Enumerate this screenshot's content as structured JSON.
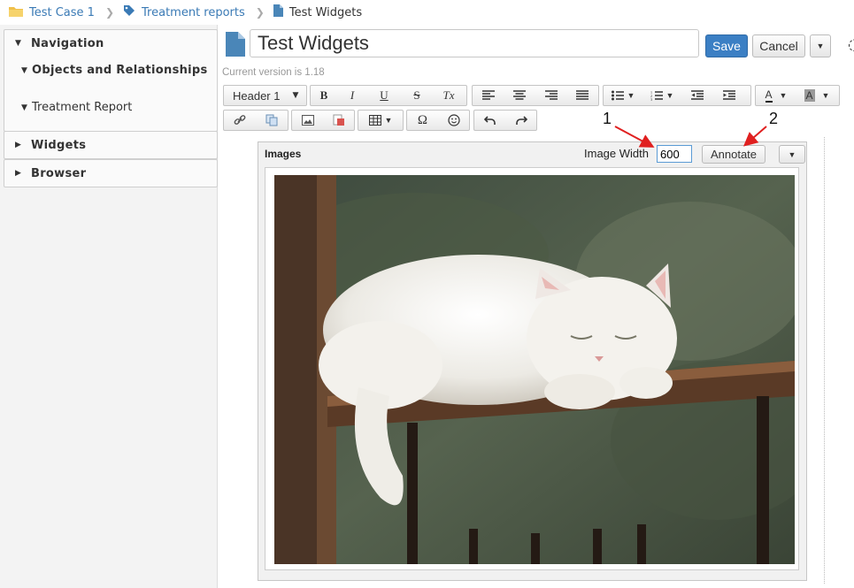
{
  "breadcrumb": {
    "items": [
      {
        "label": "Test Case 1",
        "icon": "folder-icon"
      },
      {
        "label": "Treatment reports",
        "icon": "tag-icon"
      },
      {
        "label": "Test Widgets",
        "icon": "document-icon"
      }
    ]
  },
  "sidebar": {
    "navigation": "Navigation",
    "objects": "Objects and Relationships",
    "treatment": "Treatment Report",
    "widgets": "Widgets",
    "browser": "Browser"
  },
  "editor": {
    "title": "Test Widgets",
    "save": "Save",
    "cancel": "Cancel",
    "version": "Current version is 1.18"
  },
  "toolbar": {
    "format": "Header 1",
    "bold": "B",
    "italic": "I",
    "underline": "U",
    "strike": "S",
    "clear": "Tx",
    "omega": "Ω",
    "text_color": "A",
    "bg_color": "A"
  },
  "widget": {
    "title": "Images",
    "image_width_label": "Image Width",
    "image_width_value": "600",
    "annotate": "Annotate"
  },
  "annotations": {
    "one": "1",
    "two": "2"
  },
  "colors": {
    "link": "#3a7ab5",
    "save": "#3b7fc4",
    "arrow": "#e02020",
    "doc_icon": "#4a86b8"
  }
}
